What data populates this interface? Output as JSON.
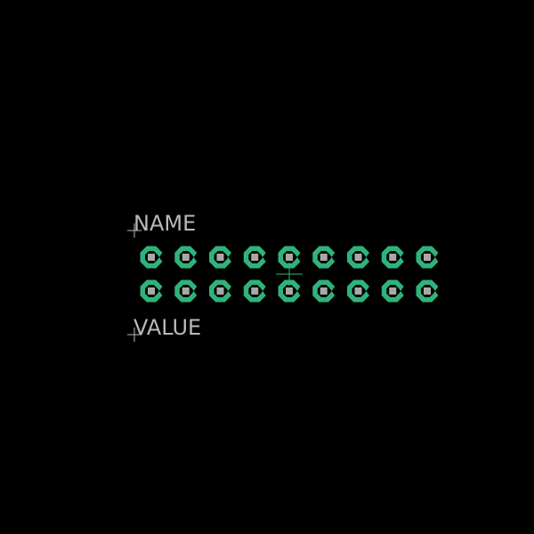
{
  "footprint": {
    "name_label": "NAME",
    "value_label": "VALUE",
    "rows": 2,
    "pins_per_row": 9,
    "pad_shape": "octagon",
    "drill_shape": "square"
  },
  "colors": {
    "background": "#000000",
    "pad": "#2fb37a",
    "drill": "#a8a8a8",
    "text": "#b8b8b8",
    "origin_marker": "#b8b8b8",
    "center_marker": "#2fb37a"
  }
}
